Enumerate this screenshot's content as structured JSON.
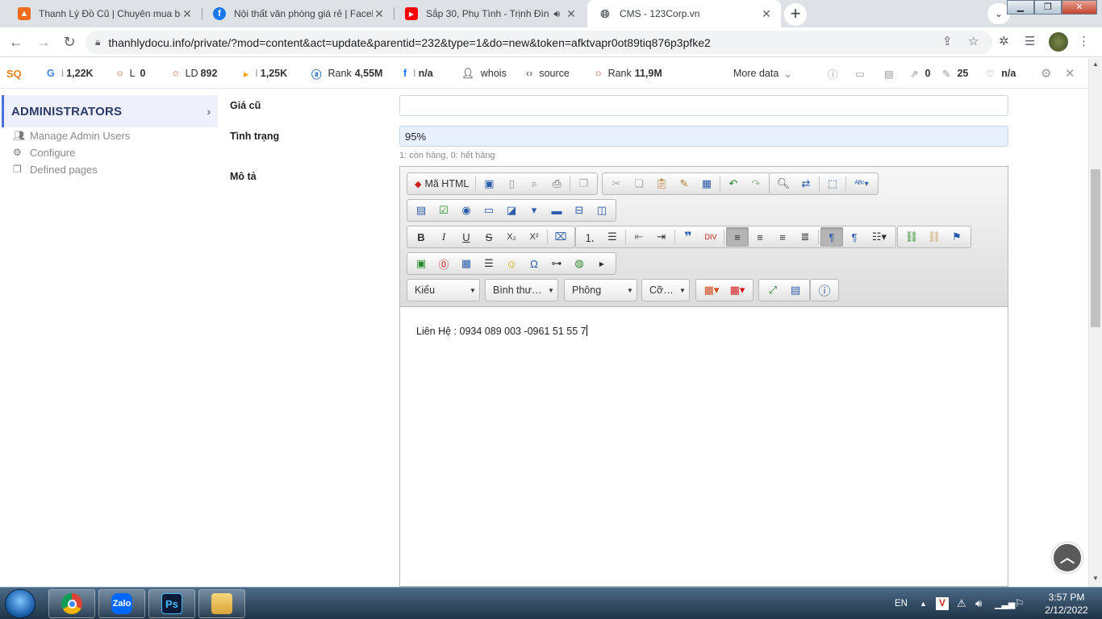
{
  "browser": {
    "tabs": [
      {
        "title": "Thanh Lý Đồ Cũ | Chuyên mua bá",
        "favicon": "shop-favicon",
        "active": false
      },
      {
        "title": "Nội thất văn phòng giá rẻ | Faceb",
        "favicon": "facebook-favicon",
        "active": false
      },
      {
        "title": "Sắp 30, Phụ Tình - Trịnh Đình",
        "favicon": "youtube-favicon",
        "active": false
      },
      {
        "title": "CMS - 123Corp.vn",
        "favicon": "globe-favicon",
        "active": true
      }
    ],
    "url": "thanhlydocu.info/private/?mod=content&act=update&parentid=232&type=1&do=new&token=afktvapr0ot89tiq876p3pfke2"
  },
  "seobar": {
    "google": "1,22K",
    "l": "0",
    "ld": "892",
    "bing": "1,25K",
    "rank_a": "4,55M",
    "facebook": "n/a",
    "whois": "whois",
    "source": "source",
    "rank_b": "11,9M",
    "more": "More data",
    "links_out": "0",
    "edits": "25",
    "trust": "n/a",
    "labels": {
      "l": "L",
      "ld": "LD",
      "rank": "Rank"
    }
  },
  "sidebar": {
    "heading": "ADMINISTRATORS",
    "items": [
      {
        "label": "Manage Admin Users"
      },
      {
        "label": "Configure"
      },
      {
        "label": "Defined pages"
      }
    ]
  },
  "form": {
    "old_price_label": "Giá cũ",
    "old_price_value": "",
    "status_label": "Tình trạng",
    "status_value": "95%",
    "status_hint": "1: còn hàng, 0: hết hàng",
    "description_label": "Mô tả"
  },
  "editor": {
    "source_button": "Mã HTML",
    "combos": {
      "style": "Kiểu",
      "format": "Bình thư…",
      "font": "Phông",
      "size": "Cỡ…"
    },
    "content": "Liên Hệ : 0934 089 003 -0961 51 55 7"
  },
  "taskbar": {
    "language": "EN",
    "time": "3:57 PM",
    "date": "2/12/2022",
    "apps": [
      "chrome",
      "zalo",
      "photoshop",
      "explorer"
    ],
    "zalo_label": "Zalo",
    "ps_label": "Ps"
  },
  "colors": {
    "accent": "#4a6fe0",
    "tabstrip": "#dee1e6",
    "input_filled": "#e8f0fe"
  }
}
